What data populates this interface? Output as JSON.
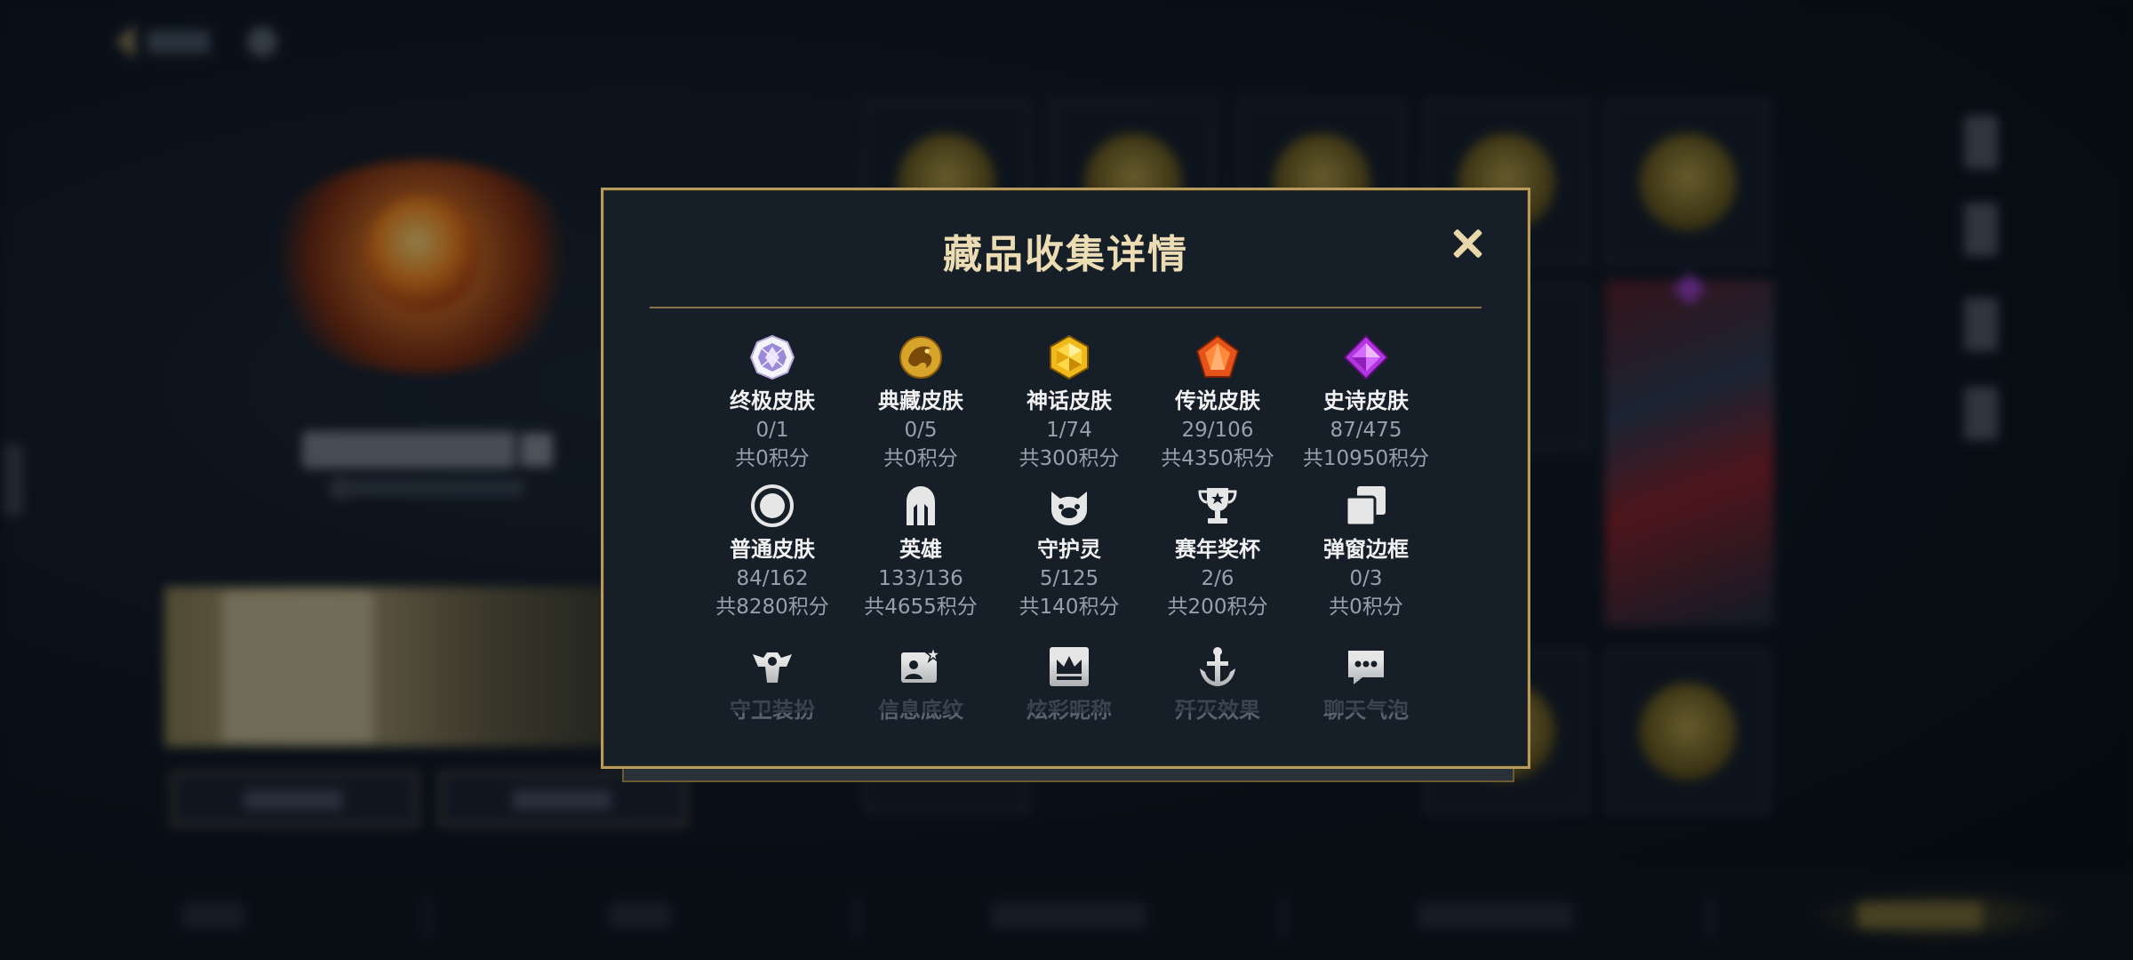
{
  "modal": {
    "title": "藏品收集详情",
    "close_icon": "close-icon"
  },
  "items": [
    {
      "label": "终极皮肤",
      "count": "0/1",
      "points": "共0积分",
      "icon": "ultimate-skin-icon"
    },
    {
      "label": "典藏皮肤",
      "count": "0/5",
      "points": "共0积分",
      "icon": "collection-skin-icon"
    },
    {
      "label": "神话皮肤",
      "count": "1/74",
      "points": "共300积分",
      "icon": "mythic-skin-icon"
    },
    {
      "label": "传说皮肤",
      "count": "29/106",
      "points": "共4350积分",
      "icon": "legend-skin-icon"
    },
    {
      "label": "史诗皮肤",
      "count": "87/475",
      "points": "共10950积分",
      "icon": "epic-skin-icon"
    },
    {
      "label": "普通皮肤",
      "count": "84/162",
      "points": "共8280积分",
      "icon": "normal-skin-icon"
    },
    {
      "label": "英雄",
      "count": "133/136",
      "points": "共4655积分",
      "icon": "hero-helmet-icon"
    },
    {
      "label": "守护灵",
      "count": "5/125",
      "points": "共140积分",
      "icon": "guardian-spirit-icon"
    },
    {
      "label": "赛年奖杯",
      "count": "2/6",
      "points": "共200积分",
      "icon": "trophy-icon"
    },
    {
      "label": "弹窗边框",
      "count": "0/3",
      "points": "共0积分",
      "icon": "popup-frame-icon"
    },
    {
      "label": "守卫装扮",
      "icon": "guard-outfit-icon"
    },
    {
      "label": "信息底纹",
      "icon": "info-pattern-icon"
    },
    {
      "label": "炫彩昵称",
      "icon": "colorful-nickname-icon"
    },
    {
      "label": "歼灭效果",
      "icon": "annihilation-effect-icon"
    },
    {
      "label": "聊天气泡",
      "icon": "chat-bubble-icon"
    }
  ],
  "colors": {
    "modal_bg": "#161e28",
    "modal_border": "#b69a5e",
    "title": "#ecdcb3",
    "label": "#f1f1f1",
    "muted": "#98a0ab"
  }
}
